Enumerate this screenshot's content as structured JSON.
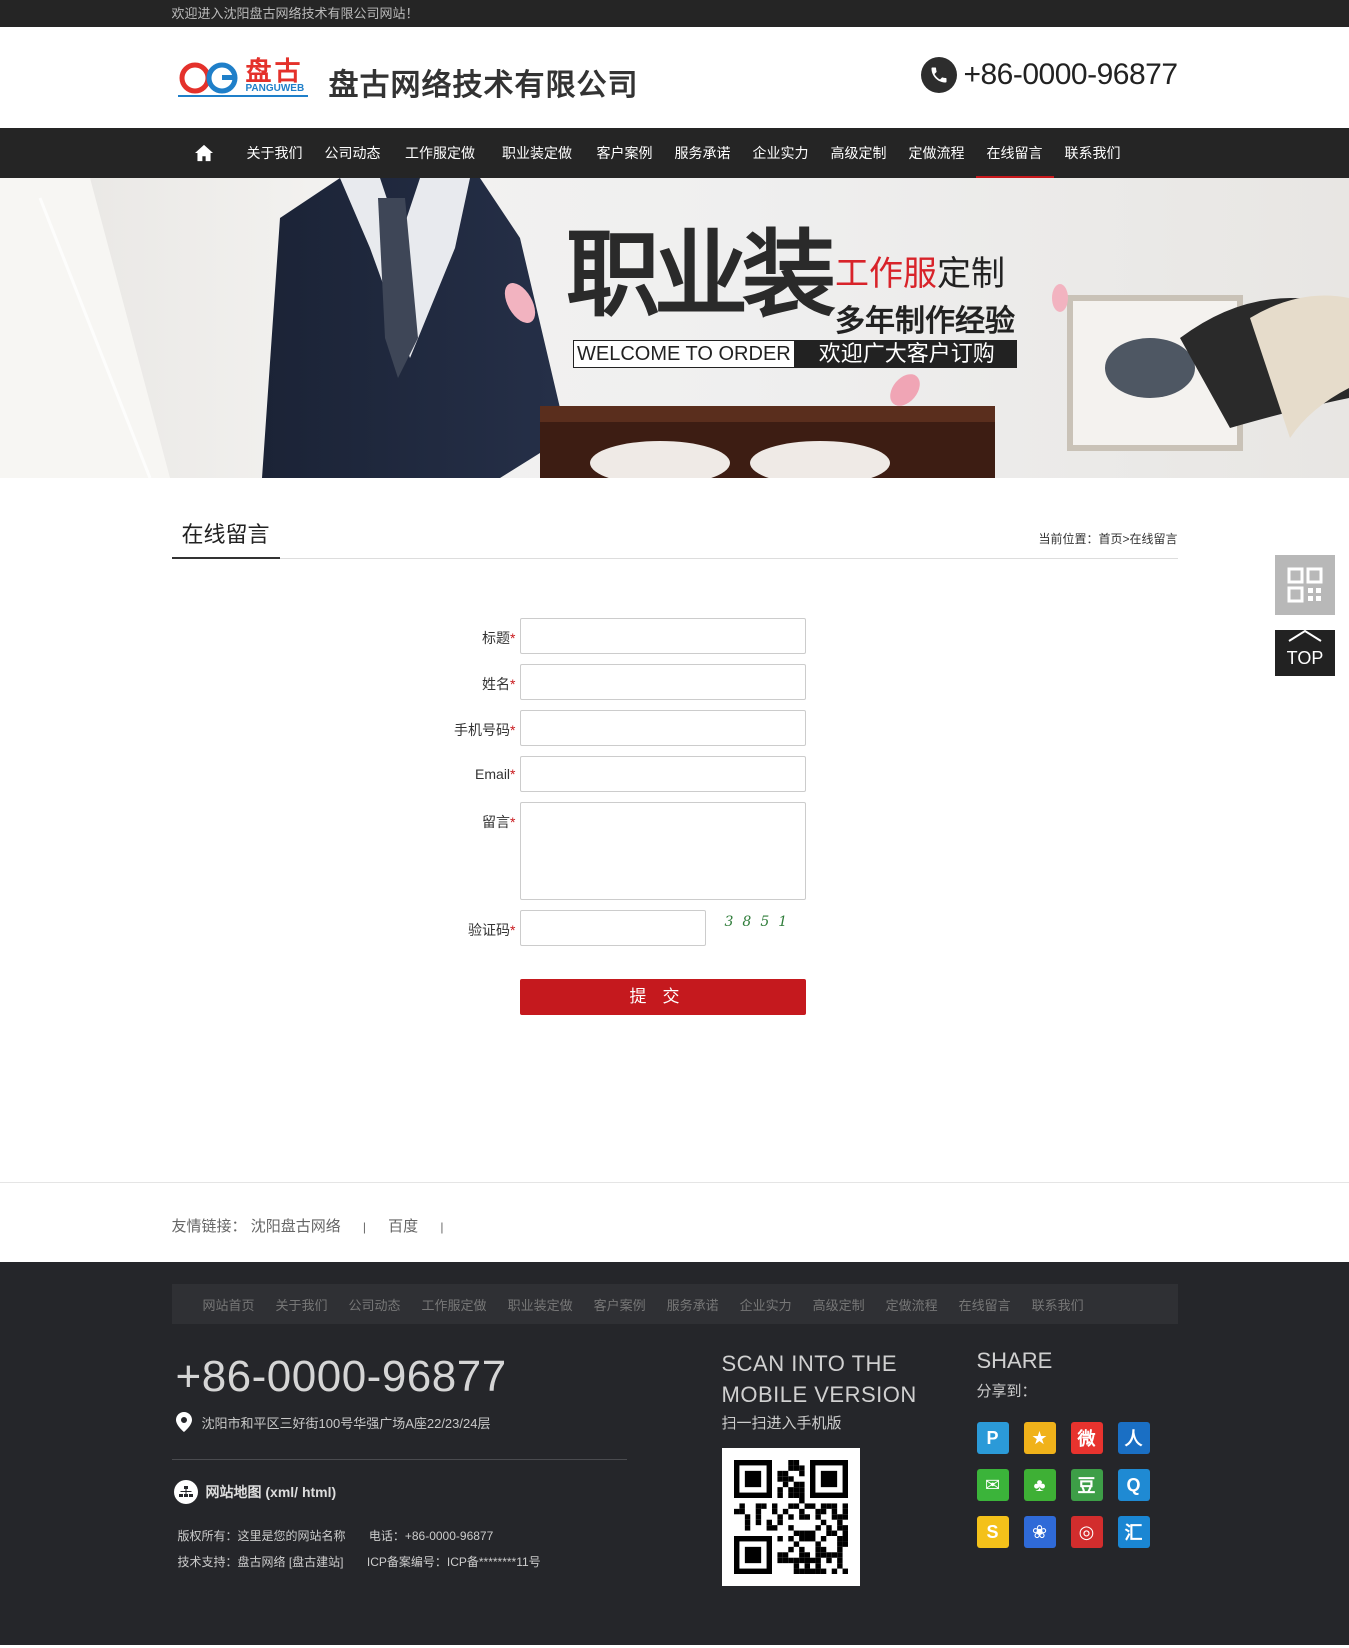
{
  "topbar": {
    "welcome": "欢迎进入沈阳盘古网络技术有限公司网站！"
  },
  "header": {
    "logo_text": "盘古",
    "logo_sub": "PANGUWEB",
    "company_name": "盘古网络技术有限公司",
    "phone": "+86-0000-96877"
  },
  "nav": {
    "home_icon": "home-icon",
    "items": [
      {
        "label": "关于我们"
      },
      {
        "label": "公司动态"
      },
      {
        "label": "工作服定做"
      },
      {
        "label": "职业装定做"
      },
      {
        "label": "客户案例"
      },
      {
        "label": "服务承诺"
      },
      {
        "label": "企业实力"
      },
      {
        "label": "高级定制"
      },
      {
        "label": "定做流程"
      },
      {
        "label": "在线留言"
      },
      {
        "label": "联系我们"
      }
    ],
    "active_index": 9
  },
  "banner": {
    "big_title": "职业装",
    "red_text": "工作服",
    "dark_text": "定制",
    "line2": "多年制作经验",
    "welcome_en": "WELCOME TO ORDER",
    "welcome_cn": "欢迎广大客户订购"
  },
  "page": {
    "title": "在线留言",
    "breadcrumb_prefix": "当前位置：",
    "breadcrumb_home": "首页",
    "breadcrumb_sep": ">",
    "breadcrumb_current": "在线留言"
  },
  "form": {
    "fields": [
      {
        "label": "标题",
        "required": "*"
      },
      {
        "label": "姓名",
        "required": "*"
      },
      {
        "label": "手机号码",
        "required": "*"
      },
      {
        "label": "Email",
        "required": "*"
      },
      {
        "label": "留言",
        "required": "*"
      },
      {
        "label": "验证码",
        "required": "*"
      }
    ],
    "captcha": "3851",
    "submit_label": "提交"
  },
  "side": {
    "qr_icon": "qr-code-icon",
    "top_label": "TOP"
  },
  "links": {
    "label": "友情链接：",
    "items": [
      {
        "text": "沈阳盘古网络"
      },
      {
        "text": "百度"
      }
    ],
    "sep": "|"
  },
  "footer": {
    "nav": [
      "网站首页",
      "关于我们",
      "公司动态",
      "工作服定做",
      "职业装定做",
      "客户案例",
      "服务承诺",
      "企业实力",
      "高级定制",
      "定做流程",
      "在线留言",
      "联系我们"
    ],
    "phone": "+86-0000-96877",
    "address": "沈阳市和平区三好街100号华强广场A座22/23/24层",
    "sitemap": "网站地图 (xml/ html)",
    "copyright": "版权所有：这里是您的网站名称",
    "tel": "电话：+86-0000-96877",
    "support": "技术支持：盘古网络 [盘古建站]",
    "icp": "ICP备案编号：ICP备********11号",
    "scan_title_1": "SCAN INTO THE",
    "scan_title_2": "MOBILE VERSION",
    "scan_sub": "扫一扫进入手机版",
    "share_title": "SHARE",
    "share_sub": "分享到：",
    "share_icons": [
      {
        "name": "qzone-icon",
        "glyph": "P",
        "color": "#2b9ad8"
      },
      {
        "name": "qq-star-icon",
        "glyph": "★",
        "color": "#f0b21a"
      },
      {
        "name": "weibo-icon",
        "glyph": "微",
        "color": "#e8332e"
      },
      {
        "name": "renren-icon",
        "glyph": "人",
        "color": "#1a6fc4"
      },
      {
        "name": "wechat-icon",
        "glyph": "✉",
        "color": "#3bb43a"
      },
      {
        "name": "kaixin-icon",
        "glyph": "♣",
        "color": "#3eb035"
      },
      {
        "name": "douban-icon",
        "glyph": "豆",
        "color": "#3d9e47"
      },
      {
        "name": "qq-icon",
        "glyph": "Q",
        "color": "#1f8ad3"
      },
      {
        "name": "sohu-icon",
        "glyph": "S",
        "color": "#f4c11a"
      },
      {
        "name": "baidu-icon",
        "glyph": "❀",
        "color": "#2f6ad8"
      },
      {
        "name": "netease-icon",
        "glyph": "◎",
        "color": "#d22d2d"
      },
      {
        "name": "hui-icon",
        "glyph": "汇",
        "color": "#1a86d3"
      }
    ]
  }
}
